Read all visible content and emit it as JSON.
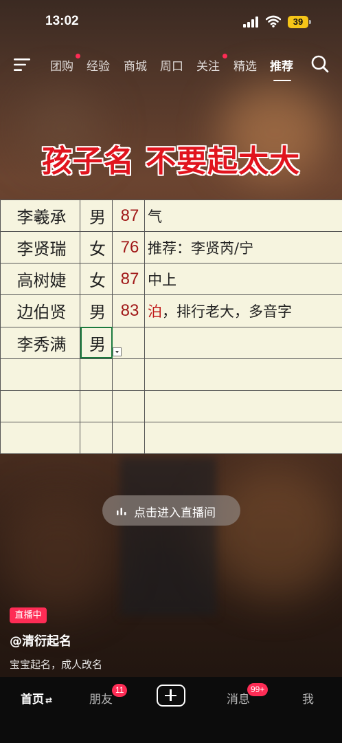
{
  "status_bar": {
    "time": "13:02",
    "battery": "39"
  },
  "top_nav": {
    "tabs": [
      {
        "label": "团购",
        "dot": true
      },
      {
        "label": "经验",
        "dot": false
      },
      {
        "label": "商城",
        "dot": false
      },
      {
        "label": "周口",
        "dot": false
      },
      {
        "label": "关注",
        "dot": true
      },
      {
        "label": "精选",
        "dot": false
      },
      {
        "label": "推荐",
        "dot": false,
        "active": true
      }
    ],
    "menu_icon": "menu-icon",
    "search_icon": "search-icon"
  },
  "banner": {
    "text": "孩子名  不要起太大"
  },
  "sheet": {
    "rows": [
      {
        "name": "李羲承",
        "gender": "男",
        "score": "87",
        "note": "气"
      },
      {
        "name": "李贤瑞",
        "gender": "女",
        "score": "76",
        "note": "推荐：李贤芮/宁"
      },
      {
        "name": "高树婕",
        "gender": "女",
        "score": "87",
        "note": "中上"
      },
      {
        "name": "边伯贤",
        "gender": "男",
        "score": "83",
        "note_highlight": "泊",
        "note": "，排行老大，多音字"
      },
      {
        "name": "李秀满",
        "gender": "男",
        "score": "",
        "note": ""
      }
    ]
  },
  "live_pill": {
    "text": "点击进入直播间",
    "icon": "live-bars-icon"
  },
  "account": {
    "live_badge": "直播中",
    "name": "@清衍起名",
    "description": "宝宝起名，成人改名"
  },
  "bottom_nav": {
    "home": "首页",
    "friends": "朋友",
    "friends_badge": "11",
    "messages": "消息",
    "messages_badge": "99+",
    "me": "我",
    "add_icon": "plus-icon"
  },
  "colors": {
    "accent": "#fe2c55",
    "banner_red": "#e1141e",
    "sheet_bg": "#f6f4df",
    "score_red": "#a01818",
    "battery_yellow": "#f5c518"
  }
}
